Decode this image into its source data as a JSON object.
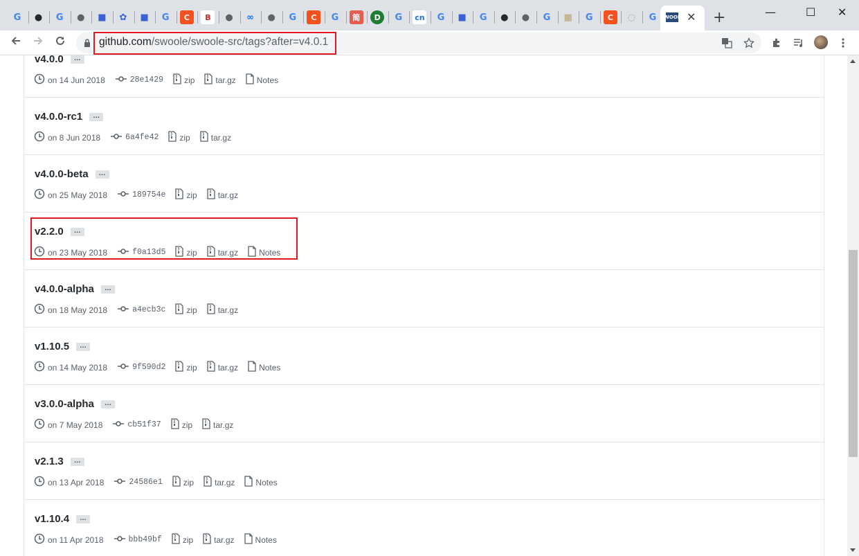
{
  "browser": {
    "tab_favicons": [
      "G",
      "github",
      "G",
      "globe",
      "chat",
      "baidu",
      "chat",
      "G",
      "C",
      "blog",
      "globe",
      "link",
      "globe",
      "G",
      "C",
      "G",
      "简",
      "Dot",
      "G",
      "cnfan",
      "G",
      "chat",
      "G",
      "github",
      "globe",
      "G",
      "img",
      "G",
      "C",
      "loading",
      "G"
    ],
    "active_tab_label": "SWOOLE",
    "close_glyph": "✕",
    "newtab_glyph": "+",
    "window": {
      "minimize": "—",
      "maximize": "☐",
      "close": "✕"
    },
    "url_host": "github.com",
    "url_path": "/swoole/swoole-src/tags?after=v4.0.1"
  },
  "tags": [
    {
      "name": "v4.0.0",
      "date": "on 14 Jun 2018",
      "sha": "28e1429",
      "zip": "zip",
      "targz": "tar.gz",
      "notes": "Notes"
    },
    {
      "name": "v4.0.0-rc1",
      "date": "on 8 Jun 2018",
      "sha": "6a4fe42",
      "zip": "zip",
      "targz": "tar.gz",
      "notes": ""
    },
    {
      "name": "v4.0.0-beta",
      "date": "on 25 May 2018",
      "sha": "189754e",
      "zip": "zip",
      "targz": "tar.gz",
      "notes": ""
    },
    {
      "name": "v2.2.0",
      "date": "on 23 May 2018",
      "sha": "f0a13d5",
      "zip": "zip",
      "targz": "tar.gz",
      "notes": "Notes"
    },
    {
      "name": "v4.0.0-alpha",
      "date": "on 18 May 2018",
      "sha": "a4ecb3c",
      "zip": "zip",
      "targz": "tar.gz",
      "notes": ""
    },
    {
      "name": "v1.10.5",
      "date": "on 14 May 2018",
      "sha": "9f590d2",
      "zip": "zip",
      "targz": "tar.gz",
      "notes": "Notes"
    },
    {
      "name": "v3.0.0-alpha",
      "date": "on 7 May 2018",
      "sha": "cb51f37",
      "zip": "zip",
      "targz": "tar.gz",
      "notes": ""
    },
    {
      "name": "v2.1.3",
      "date": "on 13 Apr 2018",
      "sha": "24586e1",
      "zip": "zip",
      "targz": "tar.gz",
      "notes": "Notes"
    },
    {
      "name": "v1.10.4",
      "date": "on 11 Apr 2018",
      "sha": "bbb49bf",
      "zip": "zip",
      "targz": "tar.gz",
      "notes": "Notes"
    }
  ],
  "ellipsis_label": "…",
  "colors": {
    "highlight": "#e0191f",
    "tabstrip": "#dee1e6",
    "row_border": "#e1e4e8"
  }
}
